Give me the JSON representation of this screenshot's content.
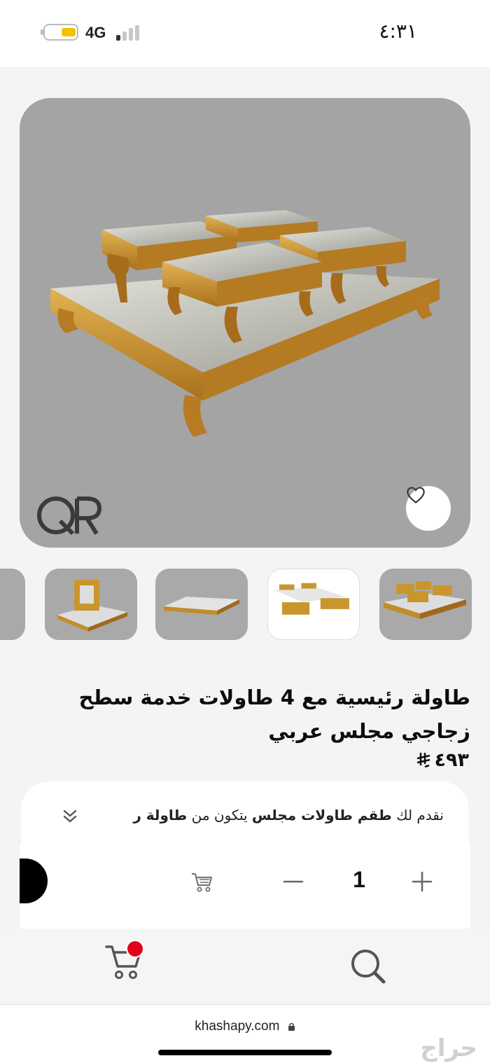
{
  "status_bar": {
    "time": "٤:٣١",
    "network": "4G"
  },
  "product": {
    "title": "طاولة رئيسية مع 4 طاولات خدمة سطح زجاجي مجلس عربي",
    "price": "٤٩٣",
    "watermark_logo": "QR"
  },
  "description": {
    "prefix": "نقدم لك ",
    "bold1": "طقم طاولات مجلس",
    "middle": " يتكون من ",
    "bold2": "طاولة ر"
  },
  "cart": {
    "quantity": "1"
  },
  "browser": {
    "url": "khashapy.com"
  },
  "watermark": "حراج",
  "icons": {
    "wishlist": "heart-icon",
    "expand": "double-chevron-down-icon",
    "add_to_cart": "cart-icon",
    "minus": "minus-icon",
    "plus": "plus-icon",
    "nav_cart": "cart-icon",
    "nav_search": "search-icon",
    "lock": "lock-icon"
  },
  "colors": {
    "accent_badge": "#e3001b",
    "gold": "#c9962e",
    "card_bg": "#a4a4a4"
  }
}
